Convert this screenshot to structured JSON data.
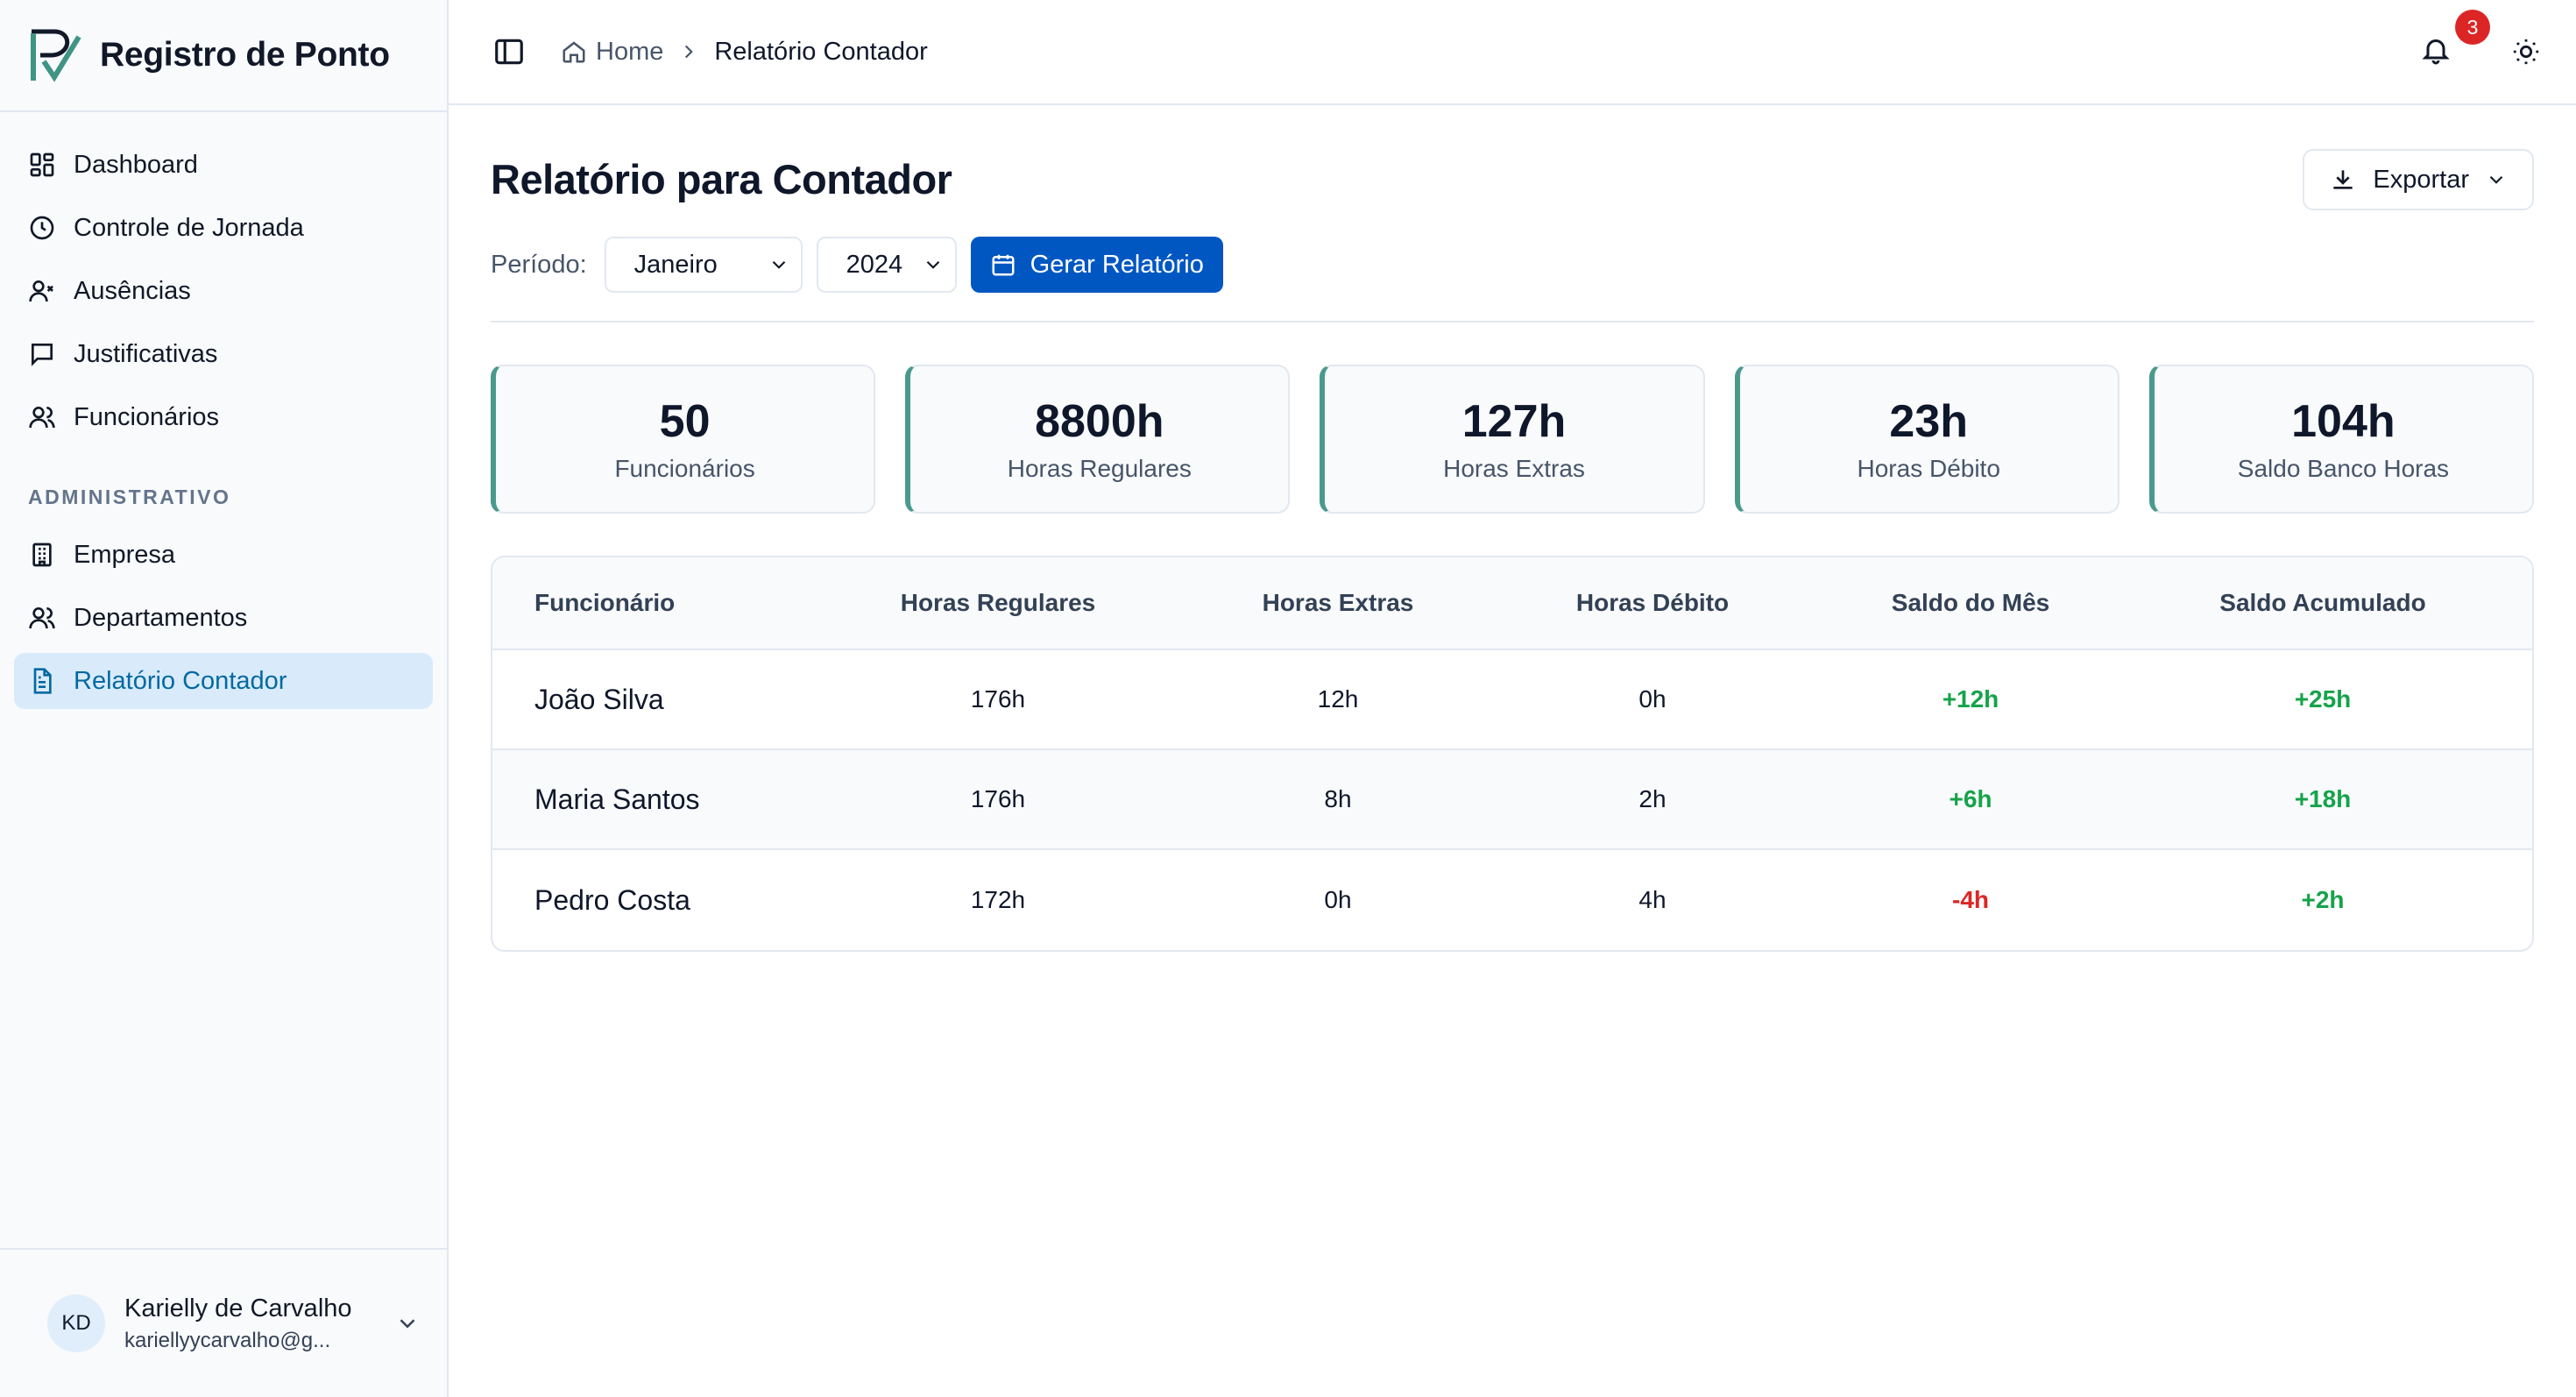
{
  "app": {
    "name": "Registro de Ponto"
  },
  "sidebar": {
    "items": [
      {
        "label": "Dashboard",
        "icon": "dashboard-icon"
      },
      {
        "label": "Controle de Jornada",
        "icon": "clock-icon"
      },
      {
        "label": "Ausências",
        "icon": "user-x-icon"
      },
      {
        "label": "Justificativas",
        "icon": "message-icon"
      },
      {
        "label": "Funcionários",
        "icon": "users-icon"
      }
    ],
    "admin_section": "ADMINISTRATIVO",
    "admin_items": [
      {
        "label": "Empresa",
        "icon": "building-icon"
      },
      {
        "label": "Departamentos",
        "icon": "users-icon"
      },
      {
        "label": "Relatório Contador",
        "icon": "file-text-icon",
        "active": true
      }
    ]
  },
  "user": {
    "initials": "KD",
    "name": "Karielly de Carvalho",
    "email": "kariellyycarvalho@g..."
  },
  "topbar": {
    "breadcrumb": {
      "home": "Home",
      "current": "Relatório Contador"
    },
    "notifications_count": "3"
  },
  "page": {
    "title": "Relatório para Contador",
    "export_label": "Exportar",
    "period_label": "Período:",
    "month": "Janeiro",
    "year": "2024",
    "generate_label": "Gerar Relatório"
  },
  "stats": [
    {
      "value": "50",
      "label": "Funcionários"
    },
    {
      "value": "8800h",
      "label": "Horas Regulares"
    },
    {
      "value": "127h",
      "label": "Horas Extras"
    },
    {
      "value": "23h",
      "label": "Horas Débito"
    },
    {
      "value": "104h",
      "label": "Saldo Banco Horas"
    }
  ],
  "table": {
    "headers": [
      "Funcionário",
      "Horas Regulares",
      "Horas Extras",
      "Horas Débito",
      "Saldo do Mês",
      "Saldo Acumulado"
    ],
    "rows": [
      [
        "João Silva",
        "176h",
        "12h",
        "0h",
        "+12h",
        "+25h"
      ],
      [
        "Maria Santos",
        "176h",
        "8h",
        "2h",
        "+6h",
        "+18h"
      ],
      [
        "Pedro Costa",
        "172h",
        "0h",
        "4h",
        "-4h",
        "+2h"
      ]
    ]
  },
  "colors": {
    "accent": "#0057c2",
    "positive": "#16a34a",
    "negative": "#dc2626",
    "stat_border": "#4a9a8c"
  }
}
